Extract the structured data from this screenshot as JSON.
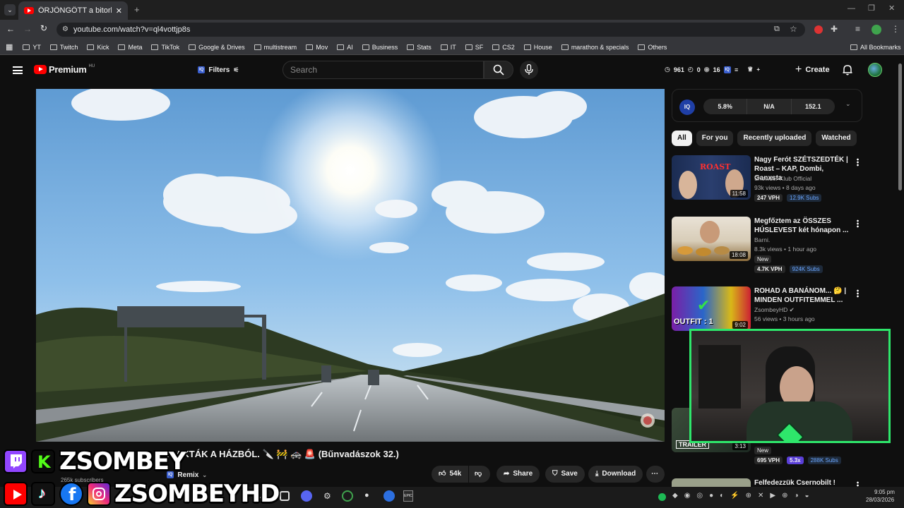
{
  "browser": {
    "tab_title": "ŐRJÖNGÖTT a bitorló, miután ki",
    "url": "youtube.com/watch?v=ql4vottjp8s",
    "bookmarks": [
      "YT",
      "Twitch",
      "Kick",
      "Meta",
      "TikTok",
      "Google & Drives",
      "multistream",
      "Mov",
      "AI",
      "Business",
      "Stats",
      "IT",
      "SF",
      "CS2",
      "House",
      "marathon & specials",
      "Others"
    ],
    "all_bookmarks": "All Bookmarks"
  },
  "header": {
    "logo": "Premium",
    "region": "HU",
    "filters": "Filters",
    "search_placeholder": "Search",
    "counter_watch": "961",
    "counter_zero": "0",
    "counter_views": "16",
    "create": "Create"
  },
  "iq": {
    "badge": "IQ",
    "stats": [
      "5.8%",
      "N/A",
      "152.1"
    ]
  },
  "chips": [
    "All",
    "For you",
    "Recently uploaded",
    "Watched"
  ],
  "videos": [
    {
      "title": "Nagy Ferót SZÉTSZEDTÉK | Roast – KAP, Dombi, Ganxsta",
      "channel": "Showder Klub Official",
      "meta": "93k views • 8 days ago",
      "duration": "11:58",
      "vph": "247 VPH",
      "subs": "12.9K Subs",
      "new": "",
      "thumb_text": "ROAST"
    },
    {
      "title": "Megfőztem az ÖSSZES HÚSLEVEST két hónapon ...",
      "channel": "Barni.",
      "meta": "8.3k views • 1 hour ago",
      "duration": "18:08",
      "vph": "4.7K VPH",
      "subs": "924K Subs",
      "new": "New",
      "thumb_text": ""
    },
    {
      "title": "ROHAD A BANÁNOM... 🤔 | MINDEN OUTFITEMMEL ...",
      "channel": "ZsombeyHD",
      "meta": "56 views • 3 hours ago",
      "duration": "9:02",
      "vph": "",
      "subs": "",
      "new": "",
      "thumb_text": "OUTFIT : 1"
    },
    {
      "title": "",
      "channel": "",
      "meta": "",
      "duration": "3:13",
      "vph": "695 VPH",
      "subs": "288K Subs",
      "new": "New",
      "thumb_text": "TRAILER",
      "ratio": "5.3x"
    },
    {
      "title": "Felfedezzük Csernobilt !",
      "channel": "",
      "meta": "",
      "duration": "",
      "vph": "",
      "subs": "",
      "new": "",
      "thumb_text": ""
    }
  ],
  "video": {
    "title_visible": "IRAKTÁK A HÁZBÓL. 🔪 🚧 🚓 🚨 (Bűnvadászok 32.)",
    "subscribers": "265k subscribers",
    "remix": "Remix",
    "likes": "54k",
    "share": "Share",
    "save": "Save",
    "download": "Download"
  },
  "overlay": {
    "name1": "ZSOMBEY",
    "name2": "ZSOMBEYHD"
  },
  "taskbar": {
    "time": "9:05 pm",
    "date": "28/03/2026"
  },
  "colors": {
    "yt_red": "#ff0000",
    "stream_green": "#2ee66b",
    "sub_blue": "#6aa6ff"
  }
}
